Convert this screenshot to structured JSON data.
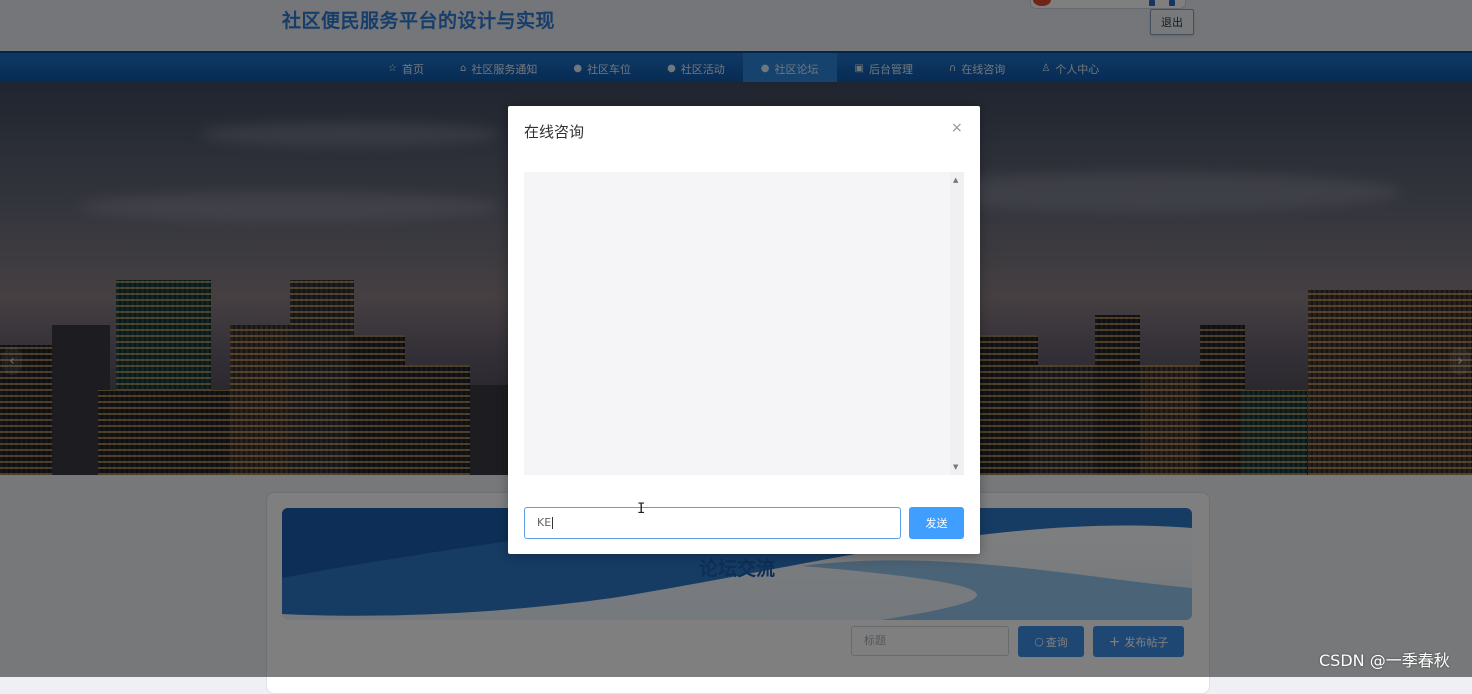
{
  "header": {
    "title": "社区便民服务平台的设计与实现",
    "logout_label": "退出"
  },
  "nav": {
    "items": [
      {
        "label": "首页",
        "icon": "star-icon",
        "glyph": "☆"
      },
      {
        "label": "社区服务通知",
        "icon": "home-icon",
        "glyph": "⌂"
      },
      {
        "label": "社区车位",
        "icon": "info-icon",
        "glyph": "●"
      },
      {
        "label": "社区活动",
        "icon": "info-icon",
        "glyph": "●"
      },
      {
        "label": "社区论坛",
        "icon": "info-icon",
        "glyph": "●",
        "active": true
      },
      {
        "label": "后台管理",
        "icon": "folder-icon",
        "glyph": "▣"
      },
      {
        "label": "在线咨询",
        "icon": "headset-icon",
        "glyph": "∩"
      },
      {
        "label": "个人中心",
        "icon": "user-icon",
        "glyph": "♙"
      }
    ]
  },
  "forum": {
    "title": "论坛交流",
    "search_placeholder": "标题",
    "query_label": "查询",
    "post_label": "发布帖子"
  },
  "modal": {
    "title": "在线咨询",
    "close_glyph": "×",
    "input_value": "KE",
    "send_label": "发送"
  },
  "watermark": "CSDN @一季春秋",
  "colors": {
    "accent": "#409eff",
    "nav": "#1664b8",
    "title": "#2f7bd4"
  }
}
